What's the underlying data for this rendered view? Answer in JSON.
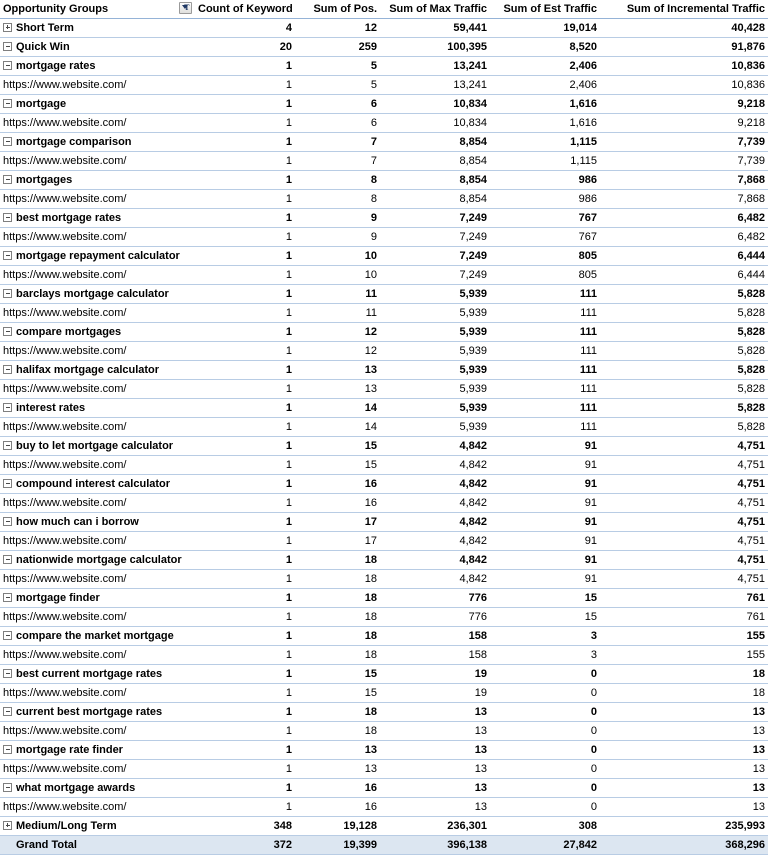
{
  "table": {
    "title": "Opportunity Groups pivot table",
    "columns": [
      {
        "key": "label",
        "header": "Opportunity Groups",
        "align": "left",
        "filter": true
      },
      {
        "key": "count",
        "header": "Count of Keyword",
        "align": "right",
        "filter": false
      },
      {
        "key": "pos",
        "header": "Sum of Pos.",
        "align": "right",
        "filter": false
      },
      {
        "key": "maxTraffic",
        "header": "Sum of Max Traffic",
        "align": "right",
        "filter": false
      },
      {
        "key": "estTraffic",
        "header": "Sum of Est Traffic",
        "align": "right",
        "filter": false
      },
      {
        "key": "incTraffic",
        "header": "Sum of Incremental Traffic",
        "align": "right",
        "filter": false
      }
    ],
    "filter_icon": "filter-sort-icon",
    "rows": [
      {
        "level": 0,
        "toggle": "plus",
        "label": "Short Term",
        "count": "4",
        "pos": "12",
        "maxTraffic": "59,441",
        "estTraffic": "19,014",
        "incTraffic": "40,428"
      },
      {
        "level": 0,
        "toggle": "minus",
        "label": "Quick Win",
        "count": "20",
        "pos": "259",
        "maxTraffic": "100,395",
        "estTraffic": "8,520",
        "incTraffic": "91,876"
      },
      {
        "level": 1,
        "toggle": "minus",
        "label": "mortgage rates",
        "count": "1",
        "pos": "5",
        "maxTraffic": "13,241",
        "estTraffic": "2,406",
        "incTraffic": "10,836"
      },
      {
        "level": 2,
        "toggle": "none",
        "label": "https://www.website.com/",
        "count": "1",
        "pos": "5",
        "maxTraffic": "13,241",
        "estTraffic": "2,406",
        "incTraffic": "10,836"
      },
      {
        "level": 1,
        "toggle": "minus",
        "label": "mortgage",
        "count": "1",
        "pos": "6",
        "maxTraffic": "10,834",
        "estTraffic": "1,616",
        "incTraffic": "9,218"
      },
      {
        "level": 2,
        "toggle": "none",
        "label": "https://www.website.com/",
        "count": "1",
        "pos": "6",
        "maxTraffic": "10,834",
        "estTraffic": "1,616",
        "incTraffic": "9,218"
      },
      {
        "level": 1,
        "toggle": "minus",
        "label": "mortgage comparison",
        "count": "1",
        "pos": "7",
        "maxTraffic": "8,854",
        "estTraffic": "1,115",
        "incTraffic": "7,739"
      },
      {
        "level": 2,
        "toggle": "none",
        "label": "https://www.website.com/",
        "count": "1",
        "pos": "7",
        "maxTraffic": "8,854",
        "estTraffic": "1,115",
        "incTraffic": "7,739"
      },
      {
        "level": 1,
        "toggle": "minus",
        "label": "mortgages",
        "count": "1",
        "pos": "8",
        "maxTraffic": "8,854",
        "estTraffic": "986",
        "incTraffic": "7,868"
      },
      {
        "level": 2,
        "toggle": "none",
        "label": "https://www.website.com/",
        "count": "1",
        "pos": "8",
        "maxTraffic": "8,854",
        "estTraffic": "986",
        "incTraffic": "7,868"
      },
      {
        "level": 1,
        "toggle": "minus",
        "label": "best mortgage rates",
        "count": "1",
        "pos": "9",
        "maxTraffic": "7,249",
        "estTraffic": "767",
        "incTraffic": "6,482"
      },
      {
        "level": 2,
        "toggle": "none",
        "label": "https://www.website.com/",
        "count": "1",
        "pos": "9",
        "maxTraffic": "7,249",
        "estTraffic": "767",
        "incTraffic": "6,482"
      },
      {
        "level": 1,
        "toggle": "minus",
        "label": "mortgage repayment calculator",
        "count": "1",
        "pos": "10",
        "maxTraffic": "7,249",
        "estTraffic": "805",
        "incTraffic": "6,444"
      },
      {
        "level": 2,
        "toggle": "none",
        "label": "https://www.website.com/",
        "count": "1",
        "pos": "10",
        "maxTraffic": "7,249",
        "estTraffic": "805",
        "incTraffic": "6,444"
      },
      {
        "level": 1,
        "toggle": "minus",
        "label": "barclays mortgage calculator",
        "count": "1",
        "pos": "11",
        "maxTraffic": "5,939",
        "estTraffic": "111",
        "incTraffic": "5,828"
      },
      {
        "level": 2,
        "toggle": "none",
        "label": "https://www.website.com/",
        "count": "1",
        "pos": "11",
        "maxTraffic": "5,939",
        "estTraffic": "111",
        "incTraffic": "5,828"
      },
      {
        "level": 1,
        "toggle": "minus",
        "label": "compare mortgages",
        "count": "1",
        "pos": "12",
        "maxTraffic": "5,939",
        "estTraffic": "111",
        "incTraffic": "5,828"
      },
      {
        "level": 2,
        "toggle": "none",
        "label": "https://www.website.com/",
        "count": "1",
        "pos": "12",
        "maxTraffic": "5,939",
        "estTraffic": "111",
        "incTraffic": "5,828"
      },
      {
        "level": 1,
        "toggle": "minus",
        "label": "halifax mortgage calculator",
        "count": "1",
        "pos": "13",
        "maxTraffic": "5,939",
        "estTraffic": "111",
        "incTraffic": "5,828"
      },
      {
        "level": 2,
        "toggle": "none",
        "label": "https://www.website.com/",
        "count": "1",
        "pos": "13",
        "maxTraffic": "5,939",
        "estTraffic": "111",
        "incTraffic": "5,828"
      },
      {
        "level": 1,
        "toggle": "minus",
        "label": "interest rates",
        "count": "1",
        "pos": "14",
        "maxTraffic": "5,939",
        "estTraffic": "111",
        "incTraffic": "5,828"
      },
      {
        "level": 2,
        "toggle": "none",
        "label": "https://www.website.com/",
        "count": "1",
        "pos": "14",
        "maxTraffic": "5,939",
        "estTraffic": "111",
        "incTraffic": "5,828"
      },
      {
        "level": 1,
        "toggle": "minus",
        "label": "buy to let mortgage calculator",
        "count": "1",
        "pos": "15",
        "maxTraffic": "4,842",
        "estTraffic": "91",
        "incTraffic": "4,751"
      },
      {
        "level": 2,
        "toggle": "none",
        "label": "https://www.website.com/",
        "count": "1",
        "pos": "15",
        "maxTraffic": "4,842",
        "estTraffic": "91",
        "incTraffic": "4,751"
      },
      {
        "level": 1,
        "toggle": "minus",
        "label": "compound interest calculator",
        "count": "1",
        "pos": "16",
        "maxTraffic": "4,842",
        "estTraffic": "91",
        "incTraffic": "4,751"
      },
      {
        "level": 2,
        "toggle": "none",
        "label": "https://www.website.com/",
        "count": "1",
        "pos": "16",
        "maxTraffic": "4,842",
        "estTraffic": "91",
        "incTraffic": "4,751"
      },
      {
        "level": 1,
        "toggle": "minus",
        "label": "how much can i borrow",
        "count": "1",
        "pos": "17",
        "maxTraffic": "4,842",
        "estTraffic": "91",
        "incTraffic": "4,751"
      },
      {
        "level": 2,
        "toggle": "none",
        "label": "https://www.website.com/",
        "count": "1",
        "pos": "17",
        "maxTraffic": "4,842",
        "estTraffic": "91",
        "incTraffic": "4,751"
      },
      {
        "level": 1,
        "toggle": "minus",
        "label": "nationwide mortgage calculator",
        "count": "1",
        "pos": "18",
        "maxTraffic": "4,842",
        "estTraffic": "91",
        "incTraffic": "4,751"
      },
      {
        "level": 2,
        "toggle": "none",
        "label": "https://www.website.com/",
        "count": "1",
        "pos": "18",
        "maxTraffic": "4,842",
        "estTraffic": "91",
        "incTraffic": "4,751"
      },
      {
        "level": 1,
        "toggle": "minus",
        "label": "mortgage finder",
        "count": "1",
        "pos": "18",
        "maxTraffic": "776",
        "estTraffic": "15",
        "incTraffic": "761"
      },
      {
        "level": 2,
        "toggle": "none",
        "label": "https://www.website.com/",
        "count": "1",
        "pos": "18",
        "maxTraffic": "776",
        "estTraffic": "15",
        "incTraffic": "761"
      },
      {
        "level": 1,
        "toggle": "minus",
        "label": "compare the market mortgage",
        "count": "1",
        "pos": "18",
        "maxTraffic": "158",
        "estTraffic": "3",
        "incTraffic": "155"
      },
      {
        "level": 2,
        "toggle": "none",
        "label": "https://www.website.com/",
        "count": "1",
        "pos": "18",
        "maxTraffic": "158",
        "estTraffic": "3",
        "incTraffic": "155"
      },
      {
        "level": 1,
        "toggle": "minus",
        "label": "best current mortgage rates",
        "count": "1",
        "pos": "15",
        "maxTraffic": "19",
        "estTraffic": "0",
        "incTraffic": "18"
      },
      {
        "level": 2,
        "toggle": "none",
        "label": "https://www.website.com/",
        "count": "1",
        "pos": "15",
        "maxTraffic": "19",
        "estTraffic": "0",
        "incTraffic": "18"
      },
      {
        "level": 1,
        "toggle": "minus",
        "label": "current best mortgage rates",
        "count": "1",
        "pos": "18",
        "maxTraffic": "13",
        "estTraffic": "0",
        "incTraffic": "13"
      },
      {
        "level": 2,
        "toggle": "none",
        "label": "https://www.website.com/",
        "count": "1",
        "pos": "18",
        "maxTraffic": "13",
        "estTraffic": "0",
        "incTraffic": "13"
      },
      {
        "level": 1,
        "toggle": "minus",
        "label": "mortgage rate finder",
        "count": "1",
        "pos": "13",
        "maxTraffic": "13",
        "estTraffic": "0",
        "incTraffic": "13"
      },
      {
        "level": 2,
        "toggle": "none",
        "label": "https://www.website.com/",
        "count": "1",
        "pos": "13",
        "maxTraffic": "13",
        "estTraffic": "0",
        "incTraffic": "13"
      },
      {
        "level": 1,
        "toggle": "minus",
        "label": "what mortgage awards",
        "count": "1",
        "pos": "16",
        "maxTraffic": "13",
        "estTraffic": "0",
        "incTraffic": "13"
      },
      {
        "level": 2,
        "toggle": "none",
        "label": "https://www.website.com/",
        "count": "1",
        "pos": "16",
        "maxTraffic": "13",
        "estTraffic": "0",
        "incTraffic": "13"
      },
      {
        "level": 0,
        "toggle": "plus",
        "label": "Medium/Long Term",
        "count": "348",
        "pos": "19,128",
        "maxTraffic": "236,301",
        "estTraffic": "308",
        "incTraffic": "235,993"
      },
      {
        "level": 0,
        "toggle": "none",
        "label": "Grand Total",
        "grandTotal": true,
        "count": "372",
        "pos": "19,399",
        "maxTraffic": "396,138",
        "estTraffic": "27,842",
        "incTraffic": "368,296"
      }
    ]
  },
  "colors": {
    "header_underline": "#95b3d7",
    "row_divider": "#b8cce4",
    "grand_total_bg": "#dce6f1",
    "grand_total_bottom": "#a6a6a6",
    "text": "#000000"
  }
}
